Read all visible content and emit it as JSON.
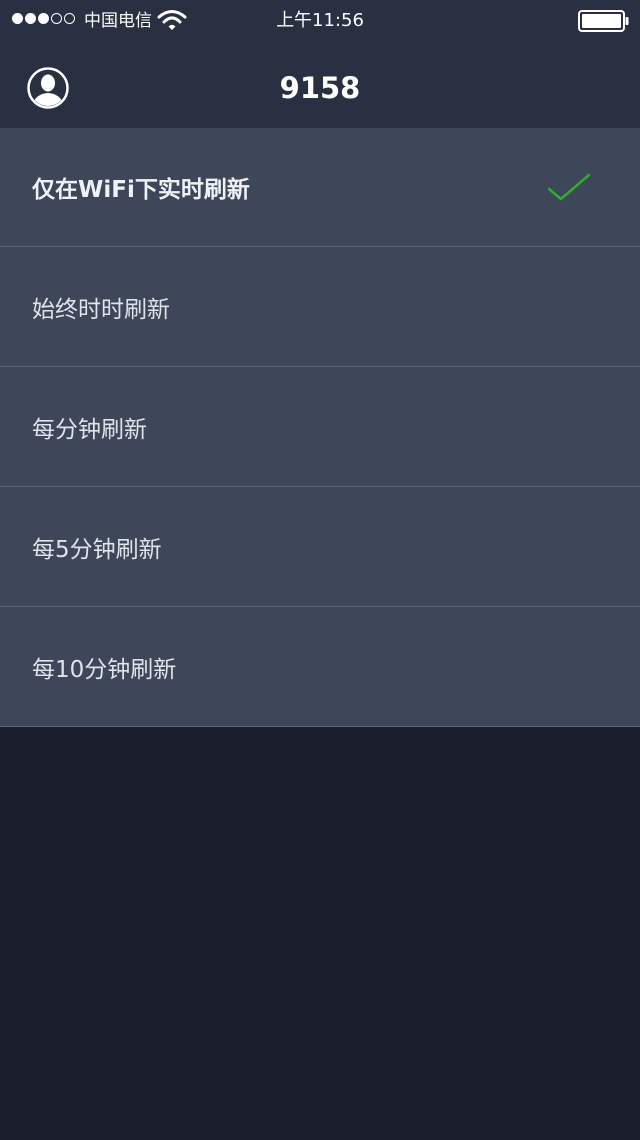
{
  "status_bar": {
    "signal_dots": [
      "filled",
      "filled",
      "filled",
      "empty",
      "empty"
    ],
    "carrier": "中国电信",
    "wifi_icon": "wifi-icon",
    "time": "上午11:56",
    "battery_icon": "battery-full-icon"
  },
  "nav": {
    "title": "9158",
    "avatar_icon": "user-avatar-icon"
  },
  "options": [
    {
      "label": "仅在WiFi下实时刷新",
      "selected": true
    },
    {
      "label": "始终时时刷新",
      "selected": false
    },
    {
      "label": "每分钟刷新",
      "selected": false
    },
    {
      "label": "每5分钟刷新",
      "selected": false
    },
    {
      "label": "每10分钟刷新",
      "selected": false
    }
  ],
  "colors": {
    "header_bg": "#283041",
    "row_bg": "#3d4759",
    "divider": "#5a6475",
    "page_bg": "#181e2b",
    "check": "#2fae2e"
  }
}
